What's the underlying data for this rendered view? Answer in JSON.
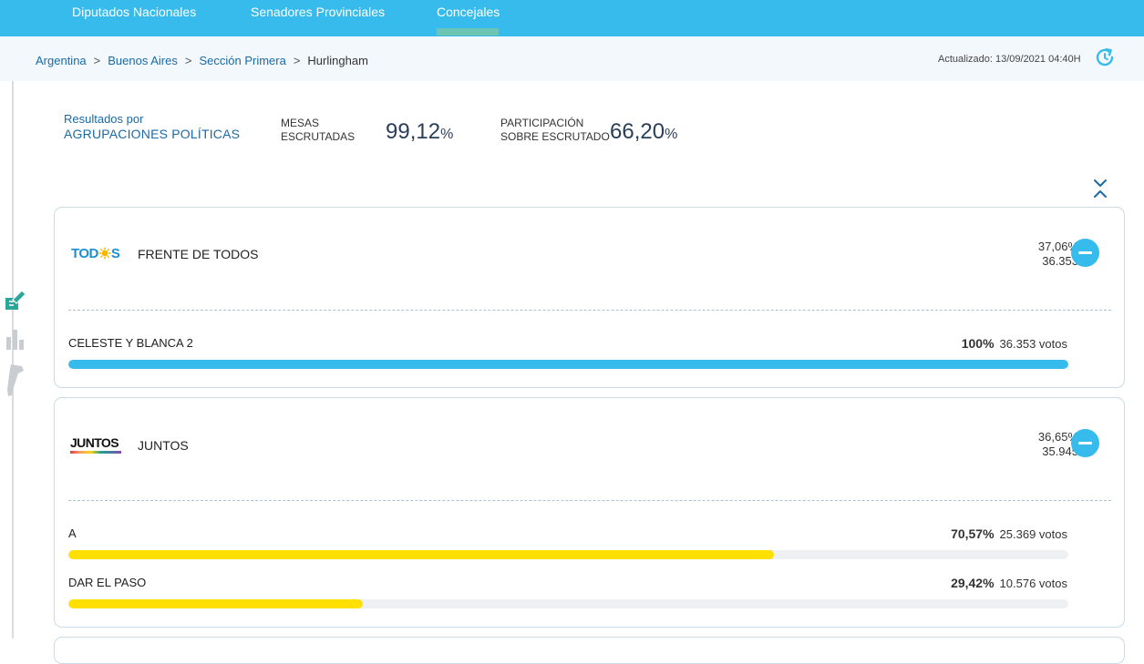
{
  "nav": {
    "tabs": [
      {
        "label": "Diputados Nacionales"
      },
      {
        "label": "Senadores Provinciales"
      },
      {
        "label": "Concejales",
        "active": true
      }
    ]
  },
  "breadcrumb": {
    "items": [
      "Argentina",
      "Buenos Aires",
      "Sección Primera"
    ],
    "current": "Hurlingham",
    "separator": ">"
  },
  "updated": "Actualizado: 13/09/2021 04:40H",
  "summary": {
    "title_line1": "Resultados por",
    "title_line2": "AGRUPACIONES POLÍTICAS",
    "mesas_label1": "MESAS",
    "mesas_label2": "ESCRUTADAS",
    "mesas_value": "99,12",
    "participacion_label1": "PARTICIPACIÓN",
    "participacion_label2": "SOBRE ESCRUTADO",
    "participacion_value": "66,20",
    "percent_sign": "%"
  },
  "colors": {
    "accent": "#37bbec",
    "link": "#1a6aa6",
    "yellow": "#ffe000",
    "track": "#eef0f3"
  },
  "parties": [
    {
      "logo_text_a": "TOD",
      "logo_text_b": "S",
      "name": "FRENTE DE TODOS",
      "pct": "37,06%",
      "votes": "36.353",
      "color": "#37bbec",
      "lists": [
        {
          "name": "CELESTE Y BLANCA 2",
          "pct": "100%",
          "votes": "36.353 votos",
          "share": 1.0
        }
      ]
    },
    {
      "logo_text": "JUNTOS",
      "name": "JUNTOS",
      "pct": "36,65%",
      "votes": "35.945",
      "color": "#ffe000",
      "lists": [
        {
          "name": "A",
          "pct": "70,57%",
          "votes": "25.369 votos",
          "share": 0.7057
        },
        {
          "name": "DAR EL PASO",
          "pct": "29,42%",
          "votes": "10.576 votos",
          "share": 0.2942
        }
      ]
    }
  ]
}
